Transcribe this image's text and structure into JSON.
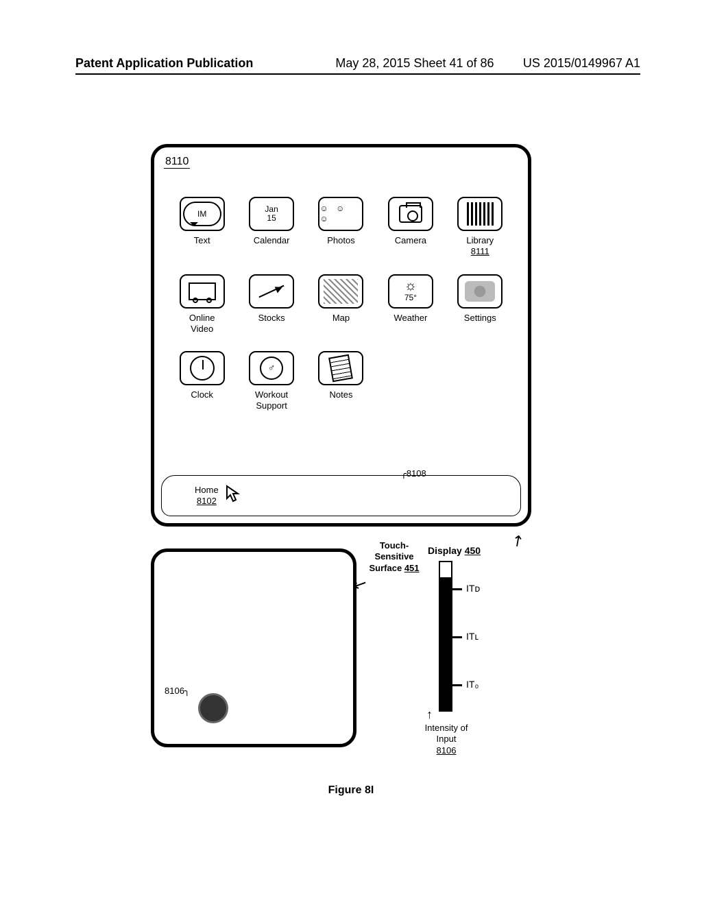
{
  "header": {
    "left": "Patent Application Publication",
    "mid": "May 28, 2015  Sheet 41 of 86",
    "right": "US 2015/0149967 A1"
  },
  "refs": {
    "display_id": "8110",
    "library_id": "8111",
    "home_id": "8102",
    "cursor_id": "8108",
    "contact_id": "8106",
    "touch_surface_id": "451",
    "display_label_id": "450",
    "intensity_input_id": "8106"
  },
  "apps": {
    "r1": [
      {
        "key": "text",
        "label": "Text",
        "inner": "IM"
      },
      {
        "key": "calendar",
        "label": "Calendar",
        "inner": "Jan\n15"
      },
      {
        "key": "photos",
        "label": "Photos",
        "inner": "☺ ☺ ☺"
      },
      {
        "key": "camera",
        "label": "Camera",
        "inner": ""
      },
      {
        "key": "library",
        "label": "Library",
        "sub": "8111",
        "inner": ""
      }
    ],
    "r2": [
      {
        "key": "online-video",
        "label": "Online\nVideo",
        "inner": ""
      },
      {
        "key": "stocks",
        "label": "Stocks",
        "inner": ""
      },
      {
        "key": "map",
        "label": "Map",
        "inner": ""
      },
      {
        "key": "weather",
        "label": "Weather",
        "inner": "75°"
      },
      {
        "key": "settings",
        "label": "Settings",
        "inner": ""
      }
    ],
    "r3": [
      {
        "key": "clock",
        "label": "Clock",
        "inner": ""
      },
      {
        "key": "workout",
        "label": "Workout\nSupport",
        "inner": "♂"
      },
      {
        "key": "notes",
        "label": "Notes",
        "inner": ""
      }
    ]
  },
  "dock": {
    "home_label": "Home"
  },
  "labels": {
    "touch_sensitive": "Touch-\nSensitive\nSurface",
    "display": "Display",
    "intensity_caption": "Intensity of\nInput",
    "itd": "ITᴅ",
    "itl": "ITʟ",
    "it0": "IT₀"
  },
  "gauge": {
    "fill_pct": 90,
    "tick_d_pct": 18,
    "tick_l_pct": 50,
    "tick_0_pct": 82
  },
  "figure": "Figure 8I"
}
